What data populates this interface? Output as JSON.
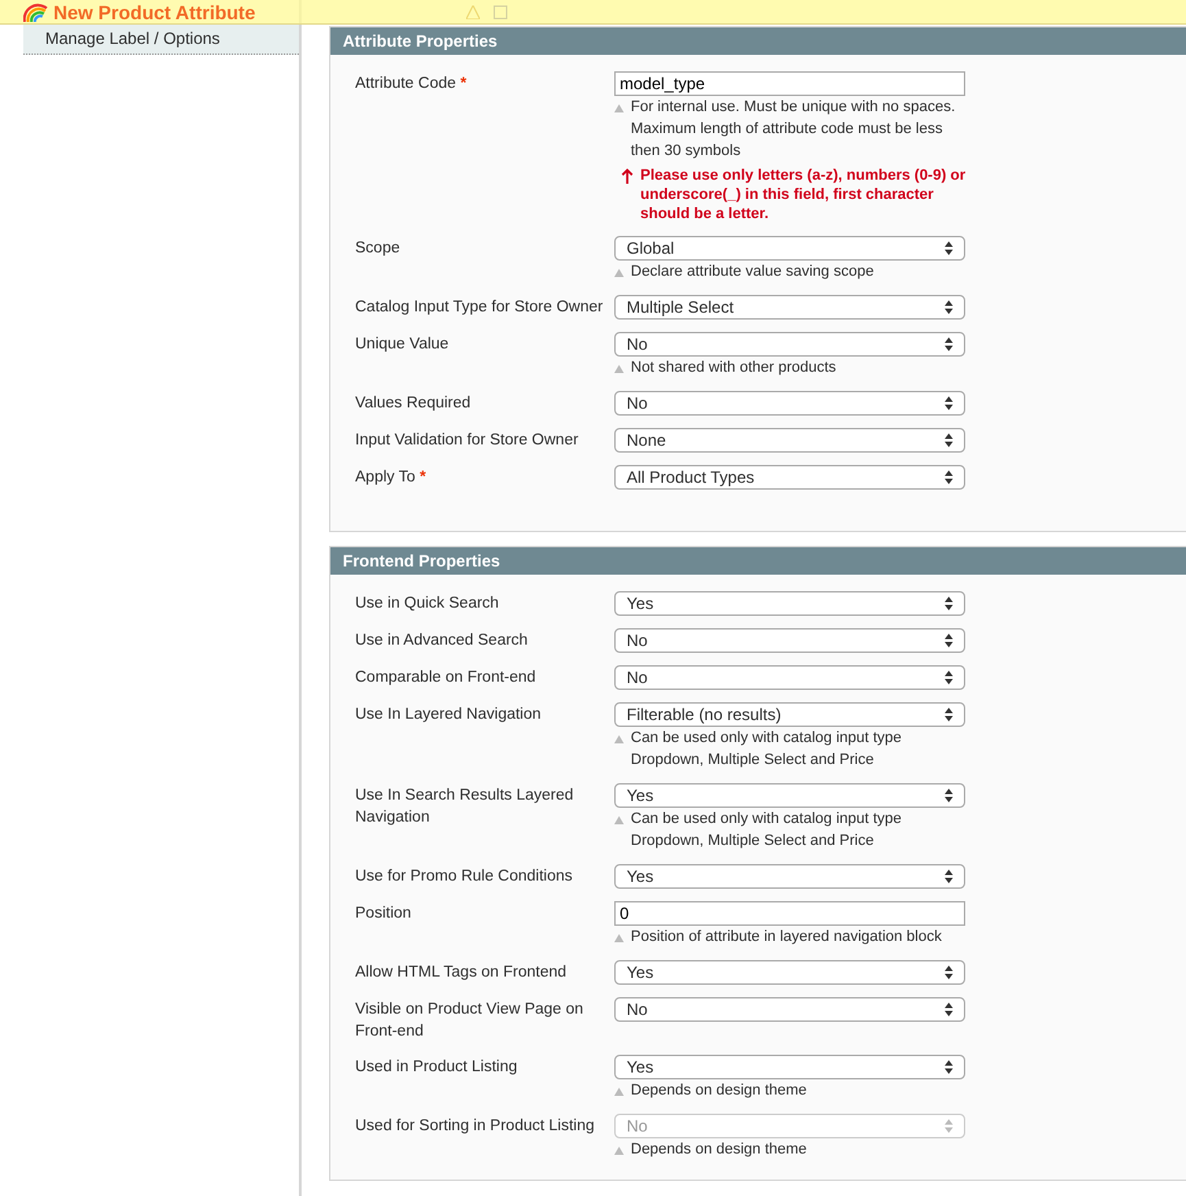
{
  "banner": {
    "title": "New Product Attribute"
  },
  "sidebar": {
    "items": [
      {
        "label": "Manage Label / Options",
        "selected": true
      }
    ]
  },
  "sections": [
    {
      "title": "Attribute Properties",
      "fields": [
        {
          "label": "Attribute Code",
          "required_mark": "*",
          "kind": "text",
          "value": "model_type",
          "notes": [
            "For internal use. Must be unique with no spaces.",
            "Maximum length of attribute code must be less",
            "then 30 symbols"
          ],
          "error": "Please use only letters (a-z), numbers (0-9) or underscore(_) in this field, first character should be a letter."
        },
        {
          "label": "Scope",
          "kind": "select",
          "value": "Global",
          "disabled": false,
          "notes": [
            "Declare attribute value saving scope"
          ]
        },
        {
          "label": "Catalog Input Type for Store Owner",
          "kind": "select",
          "value": "Multiple Select",
          "disabled": false
        },
        {
          "label": "Unique Value",
          "kind": "select",
          "value": "No",
          "disabled": false,
          "notes": [
            "Not shared with other products"
          ]
        },
        {
          "label": "Values Required",
          "kind": "select",
          "value": "No",
          "disabled": false
        },
        {
          "label": "Input Validation for Store Owner",
          "kind": "select",
          "value": "None",
          "disabled": false
        },
        {
          "label": "Apply To",
          "required_mark": "*",
          "kind": "select",
          "value": "All Product Types",
          "disabled": false
        }
      ]
    },
    {
      "title": "Frontend Properties",
      "fields": [
        {
          "label": "Use in Quick Search",
          "kind": "select",
          "value": "Yes",
          "disabled": false
        },
        {
          "label": "Use in Advanced Search",
          "kind": "select",
          "value": "No",
          "disabled": false
        },
        {
          "label": "Comparable on Front-end",
          "kind": "select",
          "value": "No",
          "disabled": false
        },
        {
          "label": "Use In Layered Navigation",
          "kind": "select",
          "value": "Filterable (no results)",
          "disabled": false,
          "notes": [
            "Can be used only with catalog input type",
            "Dropdown, Multiple Select and Price"
          ]
        },
        {
          "label": "Use In Search Results Layered Navigation",
          "kind": "select",
          "value": "Yes",
          "disabled": false,
          "notes": [
            "Can be used only with catalog input type",
            "Dropdown, Multiple Select and Price"
          ]
        },
        {
          "label": "Use for Promo Rule Conditions",
          "kind": "select",
          "value": "Yes",
          "disabled": false
        },
        {
          "label": "Position",
          "kind": "text",
          "value": "0",
          "notes": [
            "Position of attribute in layered navigation block"
          ]
        },
        {
          "label": "Allow HTML Tags on Frontend",
          "kind": "select",
          "value": "Yes",
          "disabled": false
        },
        {
          "label": "Visible on Product View Page on Front-end",
          "kind": "select",
          "value": "No",
          "disabled": false
        },
        {
          "label": "Used in Product Listing",
          "kind": "select",
          "value": "Yes",
          "disabled": false,
          "notes": [
            "Depends on design theme"
          ]
        },
        {
          "label": "Used for Sorting in Product Listing",
          "kind": "select",
          "value": "No",
          "disabled": true,
          "notes": [
            "Depends on design theme"
          ]
        }
      ]
    }
  ]
}
